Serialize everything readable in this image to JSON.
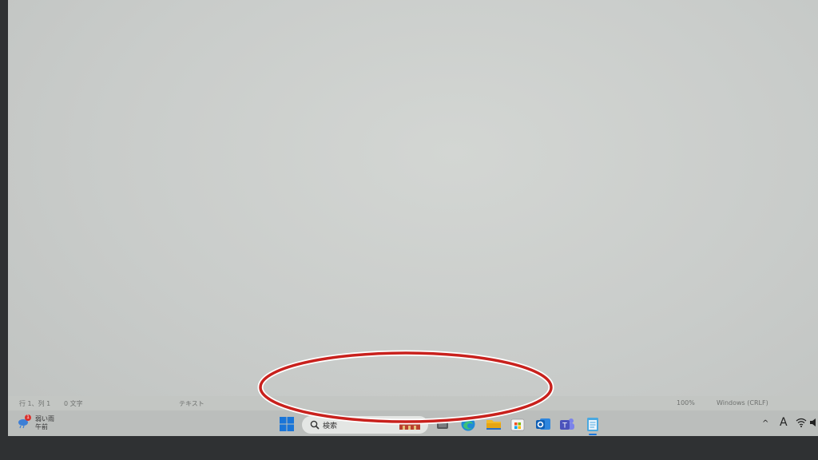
{
  "status_bar": {
    "position": "行 1、列 1",
    "char_count": "0 文字",
    "file_type": "テキスト",
    "zoom": "100%",
    "line_ending": "Windows (CRLF)"
  },
  "taskbar": {
    "weather": {
      "badge": "1",
      "condition": "弱い雨",
      "period": "午前"
    },
    "search_placeholder": "検索",
    "apps": [
      "task-view-icon",
      "edge-icon",
      "file-explorer-icon",
      "microsoft-store-icon",
      "outlook-icon",
      "teams-icon",
      "notepad-icon"
    ],
    "tray": {
      "ime_label": "A",
      "chevron": "^"
    }
  },
  "annotation": {
    "shape": "ellipse",
    "color": "#c8211d"
  }
}
